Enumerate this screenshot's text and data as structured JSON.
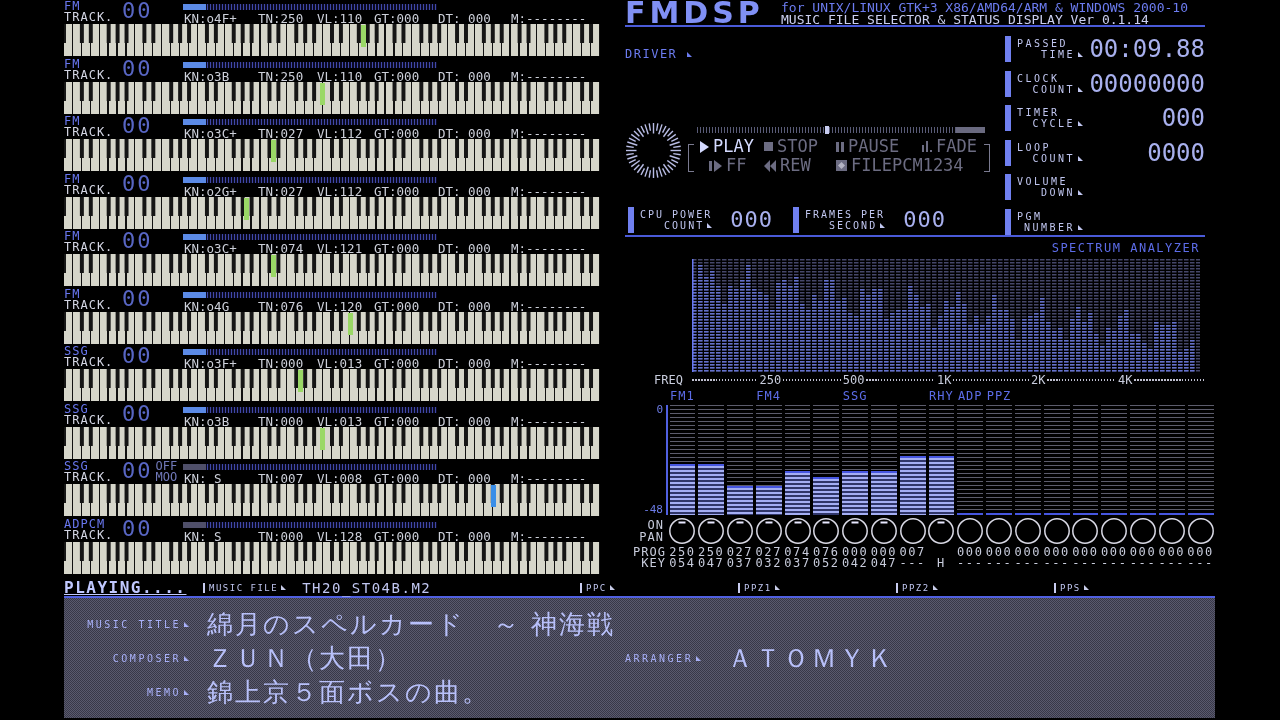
{
  "tracks": [
    {
      "type": "FM",
      "label": "TRACK.",
      "number": "00",
      "level_bar": {
        "level": 0.09,
        "color": "#5b8ae6"
      },
      "fields": [
        "KN:o4F+",
        "TN:250",
        "VL:110",
        "GT:000",
        "DT: 000",
        "M:--------"
      ],
      "pressed_key": {
        "level": 0.558,
        "color": "#9ad866"
      }
    },
    {
      "type": "FM",
      "label": "TRACK.",
      "number": "00",
      "level_bar": {
        "level": 0.09,
        "color": "#5b8ae6"
      },
      "fields": [
        "KN:o3B",
        "TN:250",
        "VL:110",
        "GT:000",
        "DT: 000",
        "M:--------"
      ],
      "pressed_key": {
        "level": 0.483,
        "color": "#9ad866"
      }
    },
    {
      "type": "FM",
      "label": "TRACK.",
      "number": "00",
      "level_bar": {
        "level": 0.09,
        "color": "#5b8ae6"
      },
      "fields": [
        "KN:o3C+",
        "TN:027",
        "VL:112",
        "GT:000",
        "DT: 000",
        "M:--------"
      ],
      "pressed_key": {
        "level": 0.39,
        "color": "#9ad866"
      }
    },
    {
      "type": "FM",
      "label": "TRACK.",
      "number": "00",
      "level_bar": {
        "level": 0.09,
        "color": "#5b8ae6"
      },
      "fields": [
        "KN:o2G+",
        "TN:027",
        "VL:112",
        "GT:000",
        "DT: 000",
        "M:--------"
      ],
      "pressed_key": {
        "level": 0.34,
        "color": "#9ad866"
      }
    },
    {
      "type": "FM",
      "label": "TRACK.",
      "number": "00",
      "level_bar": {
        "level": 0.09,
        "color": "#5b8ae6"
      },
      "fields": [
        "KN:o3C+",
        "TN:074",
        "VL:121",
        "GT:000",
        "DT: 000",
        "M:--------"
      ],
      "pressed_key": {
        "level": 0.39,
        "color": "#9ad866"
      }
    },
    {
      "type": "FM",
      "label": "TRACK.",
      "number": "00",
      "level_bar": {
        "level": 0.09,
        "color": "#5b8ae6"
      },
      "fields": [
        "KN:o4G",
        "TN:076",
        "VL:120",
        "GT:000",
        "DT: 000",
        "M:--------"
      ],
      "pressed_key": {
        "level": 0.534,
        "color": "#9ad866"
      }
    },
    {
      "type": "SSG",
      "label": "TRACK.",
      "number": "00",
      "level_bar": {
        "level": 0.09,
        "color": "#5b8ae6"
      },
      "fields": [
        "KN:o3F+",
        "TN:000",
        "VL:013",
        "GT:000",
        "DT: 000",
        "M:--------"
      ],
      "pressed_key": {
        "level": 0.442,
        "color": "#9ad866"
      }
    },
    {
      "type": "SSG",
      "label": "TRACK.",
      "number": "00",
      "level_bar": {
        "level": 0.09,
        "color": "#5b8ae6"
      },
      "fields": [
        "KN:o3B",
        "TN:000",
        "VL:013",
        "GT:000",
        "DT: 000",
        "M:--------"
      ],
      "pressed_key": {
        "level": 0.483,
        "color": "#9ad866"
      }
    },
    {
      "type": "SSG",
      "label": "TRACK.",
      "number": "00",
      "extra": [
        "OFF",
        "MOO"
      ],
      "level_bar": {
        "level": 0.09,
        "color": "#50506a"
      },
      "fields": [
        "KN: S",
        "TN:007",
        "VL:008",
        "GT:000",
        "DT: 000",
        "M:--------"
      ],
      "pressed_key": {
        "level": 0.802,
        "color": "#3a8ee8"
      }
    },
    {
      "type": "ADPCM",
      "label": "TRACK.",
      "number": "00",
      "level_bar": {
        "level": 0.09,
        "color": "#50506a"
      },
      "fields": [
        "KN: S",
        "TN:000",
        "VL:128",
        "GT:000",
        "DT: 000",
        "M:--------"
      ]
    }
  ],
  "header": {
    "logo": "FMDSP",
    "subtitle": [
      "for UNIX/LINUX GTK+3 X86/AMD64/ARM & WINDOWS 2000-10",
      "MUSIC FILE SELECTOR & STATUS DISPLAY Ver 0.1.14"
    ]
  },
  "driver": {
    "label": "DRIVER"
  },
  "transport": {
    "seek": {
      "level": 0.45
    },
    "buttons": [
      {
        "kind": "play",
        "label": "PLAY",
        "selected": true
      },
      {
        "kind": "stop",
        "label": "STOP",
        "selected": false
      },
      {
        "kind": "pause",
        "label": "PAUSE",
        "selected": false
      },
      {
        "kind": "fade",
        "label": "FADE",
        "selected": false
      },
      {
        "kind": "ff",
        "label": "FF",
        "selected": false
      },
      {
        "kind": "rew",
        "label": "REW",
        "selected": false
      },
      {
        "kind": "file",
        "label": "FILEPCM1234",
        "selected": false
      }
    ]
  },
  "counters": [
    {
      "label": [
        "CPU POWER",
        "COUNT"
      ],
      "value": "000"
    },
    {
      "label": [
        "FRAMES PER",
        "SECOND"
      ],
      "value": "000"
    }
  ],
  "stats": [
    {
      "label": [
        "PASSED",
        "TIME"
      ],
      "value": "00:09.88"
    },
    {
      "label": [
        "CLOCK",
        "COUNT"
      ],
      "value": "00000000"
    },
    {
      "label": [
        "TIMER",
        "CYCLE"
      ],
      "value": "000"
    },
    {
      "label": [
        "LOOP",
        "COUNT"
      ],
      "value": "0000"
    },
    {
      "label": [
        "VOLUME",
        "DOWN"
      ]
    },
    {
      "label": [
        "PGM",
        "NUMBER"
      ]
    }
  ],
  "spectrum": {
    "title": "SPECTRUM ANALYZER",
    "axis_label": "FREQ",
    "freq_labels": [
      "250",
      "500",
      "1K",
      "2K",
      "4K"
    ]
  },
  "mixer": {
    "scale": [
      "0",
      "-48"
    ],
    "row_labels": [
      "ON",
      "PAN",
      "PROG",
      "KEY"
    ],
    "channels": [
      {
        "group": "FM1",
        "level": 0.46,
        "on": true,
        "prog": "250",
        "key": "054"
      },
      {
        "level": 0.46,
        "on": true,
        "prog": "250",
        "key": "047"
      },
      {
        "level": 0.26,
        "on": true,
        "prog": "027",
        "key": "037"
      },
      {
        "group": "FM4",
        "level": 0.26,
        "on": true,
        "prog": "027",
        "key": "032"
      },
      {
        "level": 0.4,
        "on": true,
        "prog": "074",
        "key": "037"
      },
      {
        "level": 0.35,
        "on": true,
        "prog": "076",
        "key": "052"
      },
      {
        "group": "SSG",
        "level": 0.4,
        "on": true,
        "prog": "000",
        "key": "042"
      },
      {
        "level": 0.4,
        "on": true,
        "prog": "000",
        "key": "047"
      },
      {
        "level": 0.54,
        "on": false,
        "prog": "007",
        "key": "---"
      },
      {
        "group": "RHY",
        "level": 0.54,
        "on": true,
        "key": "H"
      },
      {
        "group": "ADP",
        "level": 0,
        "on": false,
        "prog": "000",
        "key": "---"
      },
      {
        "group": "PPZ",
        "level": 0,
        "on": false,
        "prog": "000",
        "key": "---"
      },
      {
        "level": 0,
        "on": false,
        "prog": "000",
        "key": "---"
      },
      {
        "level": 0,
        "on": false,
        "prog": "000",
        "key": "---"
      },
      {
        "level": 0,
        "on": false,
        "prog": "000",
        "key": "---"
      },
      {
        "level": 0,
        "on": false,
        "prog": "000",
        "key": "---"
      },
      {
        "level": 0,
        "on": false,
        "prog": "000",
        "key": "---"
      },
      {
        "level": 0,
        "on": false,
        "prog": "000",
        "key": "---"
      },
      {
        "level": 0,
        "on": false,
        "prog": "000",
        "key": "---"
      }
    ]
  },
  "status_bar": {
    "state": "PLAYING....",
    "items": [
      {
        "label": "MUSIC FILE",
        "value": "TH20_ST04B.M2"
      },
      {
        "label": "PPC"
      },
      {
        "label": "PPZ1"
      },
      {
        "label": "PPZ2"
      },
      {
        "label": "PPS"
      }
    ]
  },
  "info": {
    "rows": [
      {
        "fields": [
          {
            "label": "MUSIC TITLE",
            "value": "綿月のスペルカード　～ 神海戦"
          }
        ]
      },
      {
        "fields": [
          {
            "label": "COMPOSER",
            "value": "ＺＵＮ（大田）"
          },
          {
            "label": "ARRANGER",
            "value": "ＡＴＯＭＹＫ"
          }
        ]
      },
      {
        "fields": [
          {
            "label": "MEMO",
            "value": "錦上京５面ボスの曲。"
          }
        ]
      }
    ]
  }
}
